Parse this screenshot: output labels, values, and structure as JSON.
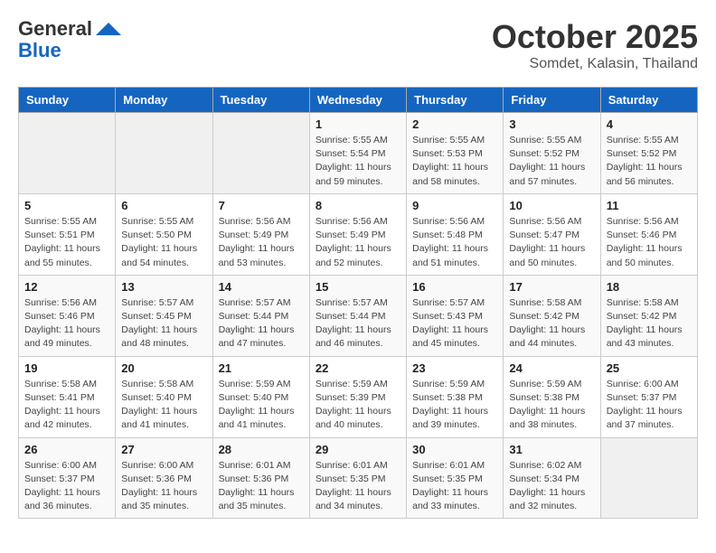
{
  "logo": {
    "general": "General",
    "blue": "Blue"
  },
  "header": {
    "month": "October 2025",
    "location": "Somdet, Kalasin, Thailand"
  },
  "weekdays": [
    "Sunday",
    "Monday",
    "Tuesday",
    "Wednesday",
    "Thursday",
    "Friday",
    "Saturday"
  ],
  "weeks": [
    [
      {
        "day": "",
        "info": ""
      },
      {
        "day": "",
        "info": ""
      },
      {
        "day": "",
        "info": ""
      },
      {
        "day": "1",
        "info": "Sunrise: 5:55 AM\nSunset: 5:54 PM\nDaylight: 11 hours\nand 59 minutes."
      },
      {
        "day": "2",
        "info": "Sunrise: 5:55 AM\nSunset: 5:53 PM\nDaylight: 11 hours\nand 58 minutes."
      },
      {
        "day": "3",
        "info": "Sunrise: 5:55 AM\nSunset: 5:52 PM\nDaylight: 11 hours\nand 57 minutes."
      },
      {
        "day": "4",
        "info": "Sunrise: 5:55 AM\nSunset: 5:52 PM\nDaylight: 11 hours\nand 56 minutes."
      }
    ],
    [
      {
        "day": "5",
        "info": "Sunrise: 5:55 AM\nSunset: 5:51 PM\nDaylight: 11 hours\nand 55 minutes."
      },
      {
        "day": "6",
        "info": "Sunrise: 5:55 AM\nSunset: 5:50 PM\nDaylight: 11 hours\nand 54 minutes."
      },
      {
        "day": "7",
        "info": "Sunrise: 5:56 AM\nSunset: 5:49 PM\nDaylight: 11 hours\nand 53 minutes."
      },
      {
        "day": "8",
        "info": "Sunrise: 5:56 AM\nSunset: 5:49 PM\nDaylight: 11 hours\nand 52 minutes."
      },
      {
        "day": "9",
        "info": "Sunrise: 5:56 AM\nSunset: 5:48 PM\nDaylight: 11 hours\nand 51 minutes."
      },
      {
        "day": "10",
        "info": "Sunrise: 5:56 AM\nSunset: 5:47 PM\nDaylight: 11 hours\nand 50 minutes."
      },
      {
        "day": "11",
        "info": "Sunrise: 5:56 AM\nSunset: 5:46 PM\nDaylight: 11 hours\nand 50 minutes."
      }
    ],
    [
      {
        "day": "12",
        "info": "Sunrise: 5:56 AM\nSunset: 5:46 PM\nDaylight: 11 hours\nand 49 minutes."
      },
      {
        "day": "13",
        "info": "Sunrise: 5:57 AM\nSunset: 5:45 PM\nDaylight: 11 hours\nand 48 minutes."
      },
      {
        "day": "14",
        "info": "Sunrise: 5:57 AM\nSunset: 5:44 PM\nDaylight: 11 hours\nand 47 minutes."
      },
      {
        "day": "15",
        "info": "Sunrise: 5:57 AM\nSunset: 5:44 PM\nDaylight: 11 hours\nand 46 minutes."
      },
      {
        "day": "16",
        "info": "Sunrise: 5:57 AM\nSunset: 5:43 PM\nDaylight: 11 hours\nand 45 minutes."
      },
      {
        "day": "17",
        "info": "Sunrise: 5:58 AM\nSunset: 5:42 PM\nDaylight: 11 hours\nand 44 minutes."
      },
      {
        "day": "18",
        "info": "Sunrise: 5:58 AM\nSunset: 5:42 PM\nDaylight: 11 hours\nand 43 minutes."
      }
    ],
    [
      {
        "day": "19",
        "info": "Sunrise: 5:58 AM\nSunset: 5:41 PM\nDaylight: 11 hours\nand 42 minutes."
      },
      {
        "day": "20",
        "info": "Sunrise: 5:58 AM\nSunset: 5:40 PM\nDaylight: 11 hours\nand 41 minutes."
      },
      {
        "day": "21",
        "info": "Sunrise: 5:59 AM\nSunset: 5:40 PM\nDaylight: 11 hours\nand 41 minutes."
      },
      {
        "day": "22",
        "info": "Sunrise: 5:59 AM\nSunset: 5:39 PM\nDaylight: 11 hours\nand 40 minutes."
      },
      {
        "day": "23",
        "info": "Sunrise: 5:59 AM\nSunset: 5:38 PM\nDaylight: 11 hours\nand 39 minutes."
      },
      {
        "day": "24",
        "info": "Sunrise: 5:59 AM\nSunset: 5:38 PM\nDaylight: 11 hours\nand 38 minutes."
      },
      {
        "day": "25",
        "info": "Sunrise: 6:00 AM\nSunset: 5:37 PM\nDaylight: 11 hours\nand 37 minutes."
      }
    ],
    [
      {
        "day": "26",
        "info": "Sunrise: 6:00 AM\nSunset: 5:37 PM\nDaylight: 11 hours\nand 36 minutes."
      },
      {
        "day": "27",
        "info": "Sunrise: 6:00 AM\nSunset: 5:36 PM\nDaylight: 11 hours\nand 35 minutes."
      },
      {
        "day": "28",
        "info": "Sunrise: 6:01 AM\nSunset: 5:36 PM\nDaylight: 11 hours\nand 35 minutes."
      },
      {
        "day": "29",
        "info": "Sunrise: 6:01 AM\nSunset: 5:35 PM\nDaylight: 11 hours\nand 34 minutes."
      },
      {
        "day": "30",
        "info": "Sunrise: 6:01 AM\nSunset: 5:35 PM\nDaylight: 11 hours\nand 33 minutes."
      },
      {
        "day": "31",
        "info": "Sunrise: 6:02 AM\nSunset: 5:34 PM\nDaylight: 11 hours\nand 32 minutes."
      },
      {
        "day": "",
        "info": ""
      }
    ]
  ]
}
